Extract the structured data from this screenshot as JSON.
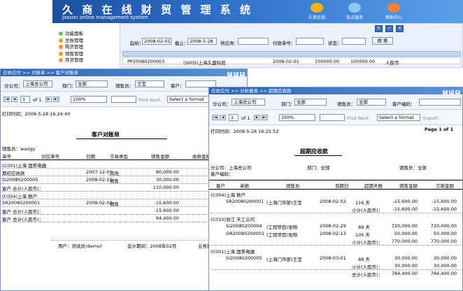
{
  "app": {
    "title": "久 商 在 线 财 贸 管 理 系 统",
    "subtitle": "Josson online management system",
    "icons": [
      {
        "label": "久商在线",
        "color": "#f1b51c"
      },
      {
        "label": "热点服务",
        "color": "#8fc6f2"
      },
      {
        "label": "帮助中心",
        "color": "#e7833a"
      }
    ]
  },
  "nav": {
    "items": [
      "功能面板",
      "总账管理",
      "购货管理",
      "销售管理",
      "存货管理"
    ]
  },
  "mainform": {
    "start_label": "起始：",
    "start_value": "2008-02-01",
    "end_label": "截止：",
    "end_value": "2008-5-28",
    "supplier_label": "供应商：",
    "payment_label": "付款单号：",
    "status_label": "状态：",
    "search_label": "搜 索",
    "row": [
      "PP20080200003",
      "(S005)上海久盛科技",
      "2008-02-01",
      "100000.00",
      "100000.00",
      "人民币"
    ]
  },
  "win1": {
    "breadcrumb": "应收应付 >> 对账单 >> 客户对账单",
    "filters": {
      "company_label": "分公司：",
      "company_value": "上海总公司",
      "dept_label": "部门：",
      "dept_value": "全部",
      "sales_label": "销售员：",
      "sales_value": "王莹",
      "customer_label": "客户：",
      "hide_label": "余额清零"
    },
    "toolbar": {
      "page": "1",
      "of": "of 1",
      "zoom": "100%",
      "find": "Find",
      "next": "Next",
      "format": "Select a format"
    },
    "print_time": "打印时间：2008-5-28 16:24:40",
    "report_title": "客户对账单",
    "salesman": "销售员：wangy",
    "headers": [
      "单号",
      "对应单号",
      "日期",
      "交易类型",
      "销售金额",
      "收款金额"
    ],
    "rows": [
      {
        "c0": "(C001)上海 国美电器",
        "c1": "",
        "c2": "",
        "c3": "",
        "c4": "",
        "c5": ""
      },
      {
        "c0": "期初应收款",
        "c1": "",
        "c2": "2007-12-01",
        "c3": "其他",
        "c4": "80,000.00",
        "c5": ""
      },
      {
        "c0": "SI20080200005",
        "c1": "",
        "c2": "2008-02-15",
        "c3": "销售",
        "c4": "30,000.00",
        "c5": ""
      },
      {
        "c0": "客户 合计(人民币)：",
        "c1": "",
        "c2": "",
        "c3": "",
        "c4": "110,000.00",
        "c5": ""
      },
      {
        "c0": "(C004)上海 数户",
        "c1": "",
        "c2": "",
        "c3": "",
        "c4": "",
        "c5": ""
      },
      {
        "c0": "SR20080200001",
        "c1": "",
        "c2": "2008-02-02",
        "c3": "销售",
        "c4": "-15,600.00",
        "c5": ""
      },
      {
        "c0": "客户 合计(人民币)：",
        "c1": "",
        "c2": "",
        "c3": "",
        "c4": "-15,600.00",
        "c5": ""
      },
      {
        "c0": "客户 总计(人民币)：",
        "c1": "",
        "c2": "",
        "c3": "",
        "c4": "94,400.00",
        "c5": ""
      }
    ],
    "footer": {
      "user": "用户：测试员(demo)",
      "period": "会计期间：2008年02月",
      "biz": "业务期"
    }
  },
  "win2": {
    "breadcrumb": "应收应付 >> 分析报表 >> 超期应收款",
    "filters": {
      "company_label": "分公司：",
      "company_value": "上海总公司",
      "dept_label": "部门：",
      "dept_value": "全部",
      "sales_label": "销售员：",
      "sales_value": "全部",
      "code_label": "客户编码："
    },
    "toolbar": {
      "page": "1",
      "of": "of 1",
      "zoom": "100%",
      "find": "Find",
      "next": "Next",
      "format": "Select a format",
      "export": "Export",
      "pageinfo": "Page 1 of 1"
    },
    "print_time": "打印时间：2008-5-28 16:25:52",
    "report_title": "超期应收款",
    "info_company": "分公司：上海总公司",
    "info_dept": "部门：全部",
    "info_sales": "销售员：全部",
    "info_code": "客户编码：",
    "headers": [
      "客户",
      "单据",
      "销售员",
      "到期日",
      "超期天数",
      "销售金额",
      "欠款金额"
    ],
    "groups": [
      {
        "name": "(C004)上海 数户",
        "rows": [
          [
            "SR20080200001",
            "(上海门市部)王莹",
            "2008-02-02",
            "116 天",
            "-15,600.00",
            "-15,600.00"
          ]
        ],
        "subtotal": [
          "小计(人民币)：",
          "-15,600.00",
          "-15,600.00"
        ]
      },
      {
        "name": "(C010)浙江 天工公司",
        "rows": [
          [
            "SI20080200004",
            "(工程项目)张翔",
            "2008-02-29",
            "89 天",
            "720,000.00",
            "720,000.00"
          ],
          [
            "OR20080200001",
            "(工程项目)张翔",
            "2008-02-13",
            "105 天",
            "50,000.00",
            "50,000.00"
          ]
        ],
        "subtotal": [
          "小计(人民币)：",
          "770,000.00",
          "770,000.00"
        ]
      },
      {
        "name": "(C001)上海 国美电器",
        "rows": [
          [
            "SI20080200005",
            "(上海门市部)王莹",
            "2008-03-01",
            "88 天",
            "30,000.00",
            "30,000.00"
          ]
        ],
        "subtotal": [
          "小计(人民币)：",
          "30,000.00",
          "30,000.00"
        ]
      }
    ],
    "total": [
      "总计(人民币)：",
      "784,400.00",
      "784,400.00"
    ]
  }
}
